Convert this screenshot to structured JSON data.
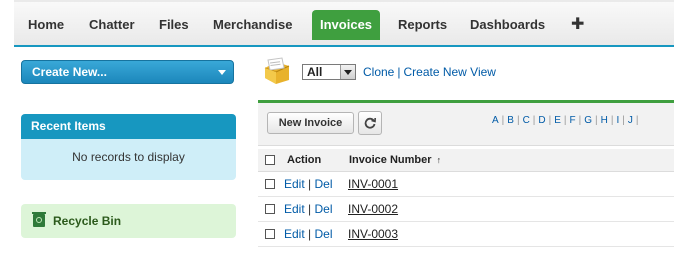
{
  "tabs": [
    {
      "label": "Home"
    },
    {
      "label": "Chatter"
    },
    {
      "label": "Files"
    },
    {
      "label": "Merchandise"
    },
    {
      "label": "Invoices",
      "active": true
    },
    {
      "label": "Reports"
    },
    {
      "label": "Dashboards"
    },
    {
      "label": "✚"
    }
  ],
  "sidebar": {
    "create_new_label": "Create New...",
    "recent_items_title": "Recent Items",
    "recent_items_empty": "No records to display",
    "recycle_bin_label": "Recycle Bin"
  },
  "view": {
    "selected": "All",
    "clone_label": "Clone",
    "separator": "|",
    "create_view_label": "Create New View"
  },
  "list": {
    "new_button_label": "New Invoice",
    "alphabet": [
      "A",
      "B",
      "C",
      "D",
      "E",
      "F",
      "G",
      "H",
      "I",
      "J"
    ],
    "columns": {
      "action": "Action",
      "number": "Invoice Number",
      "sort_indicator": "↑"
    },
    "rows": [
      {
        "edit": "Edit",
        "sep": "|",
        "del": "Del",
        "number": "INV-0001"
      },
      {
        "edit": "Edit",
        "sep": "|",
        "del": "Del",
        "number": "INV-0002"
      },
      {
        "edit": "Edit",
        "sep": "|",
        "del": "Del",
        "number": "INV-0003"
      }
    ]
  },
  "colors": {
    "accent_blue": "#1797c0",
    "active_tab_green": "#3f9f3f",
    "link_blue": "#015ba7"
  },
  "icons": {
    "header": "invoice-folder-icon",
    "refresh": "refresh-icon",
    "recycle": "recycle-bin-icon"
  }
}
